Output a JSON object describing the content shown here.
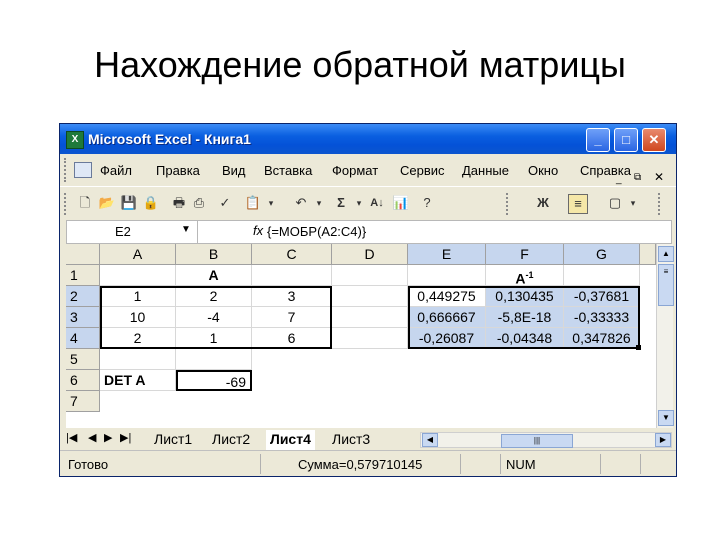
{
  "slide": {
    "title": "Нахождение обратной матрицы"
  },
  "window": {
    "title": "Microsoft Excel - Книга1"
  },
  "menu": [
    "Файл",
    "Правка",
    "Вид",
    "Вставка",
    "Формат",
    "Сервис",
    "Данные",
    "Окно",
    "Справка"
  ],
  "formula_bar": {
    "cell": "E2",
    "fx": "fx",
    "formula": "{=МОБР(A2:C4)}"
  },
  "columns": [
    "A",
    "B",
    "C",
    "D",
    "E",
    "F",
    "G"
  ],
  "rows": [
    "1",
    "2",
    "3",
    "4",
    "5",
    "6",
    "7"
  ],
  "cells": {
    "B1": "A",
    "F1": "A",
    "F1_sup": "-1",
    "A2": "1",
    "B2": "2",
    "C2": "3",
    "E2": "0,449275",
    "F2": "0,130435",
    "G2": "-0,37681",
    "A3": "10",
    "B3": "-4",
    "C3": "7",
    "E3": "0,666667",
    "F3": "-5,8E-18",
    "G3": "-0,33333",
    "A4": "2",
    "B4": "1",
    "C4": "6",
    "E4": "-0,26087",
    "F4": "-0,04348",
    "G4": "0,347826",
    "A6": "DET A",
    "B6": "-69"
  },
  "sheets": [
    "Лист1",
    "Лист2",
    "Лист4",
    "Лист3"
  ],
  "active_sheet": "Лист4",
  "status": {
    "ready": "Готово",
    "sum": "Сумма=0,579710145",
    "num": "NUM"
  }
}
